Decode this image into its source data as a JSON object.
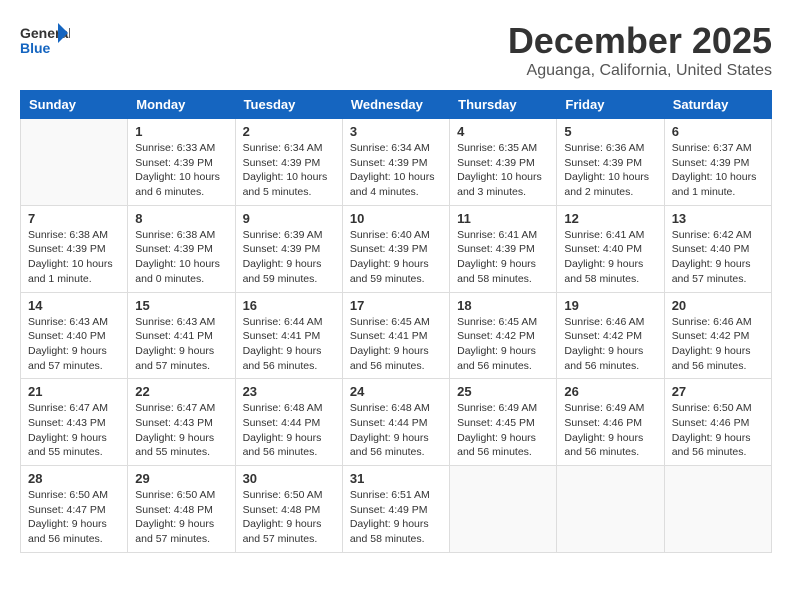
{
  "header": {
    "logo_general": "General",
    "logo_blue": "Blue",
    "month_title": "December 2025",
    "location": "Aguanga, California, United States"
  },
  "weekdays": [
    "Sunday",
    "Monday",
    "Tuesday",
    "Wednesday",
    "Thursday",
    "Friday",
    "Saturday"
  ],
  "days": [
    {
      "date": null,
      "number": "",
      "sunrise": "",
      "sunset": "",
      "daylight": ""
    },
    {
      "date": "1",
      "number": "1",
      "sunrise": "Sunrise: 6:33 AM",
      "sunset": "Sunset: 4:39 PM",
      "daylight": "Daylight: 10 hours and 6 minutes."
    },
    {
      "date": "2",
      "number": "2",
      "sunrise": "Sunrise: 6:34 AM",
      "sunset": "Sunset: 4:39 PM",
      "daylight": "Daylight: 10 hours and 5 minutes."
    },
    {
      "date": "3",
      "number": "3",
      "sunrise": "Sunrise: 6:34 AM",
      "sunset": "Sunset: 4:39 PM",
      "daylight": "Daylight: 10 hours and 4 minutes."
    },
    {
      "date": "4",
      "number": "4",
      "sunrise": "Sunrise: 6:35 AM",
      "sunset": "Sunset: 4:39 PM",
      "daylight": "Daylight: 10 hours and 3 minutes."
    },
    {
      "date": "5",
      "number": "5",
      "sunrise": "Sunrise: 6:36 AM",
      "sunset": "Sunset: 4:39 PM",
      "daylight": "Daylight: 10 hours and 2 minutes."
    },
    {
      "date": "6",
      "number": "6",
      "sunrise": "Sunrise: 6:37 AM",
      "sunset": "Sunset: 4:39 PM",
      "daylight": "Daylight: 10 hours and 1 minute."
    },
    {
      "date": "7",
      "number": "7",
      "sunrise": "Sunrise: 6:38 AM",
      "sunset": "Sunset: 4:39 PM",
      "daylight": "Daylight: 10 hours and 1 minute."
    },
    {
      "date": "8",
      "number": "8",
      "sunrise": "Sunrise: 6:38 AM",
      "sunset": "Sunset: 4:39 PM",
      "daylight": "Daylight: 10 hours and 0 minutes."
    },
    {
      "date": "9",
      "number": "9",
      "sunrise": "Sunrise: 6:39 AM",
      "sunset": "Sunset: 4:39 PM",
      "daylight": "Daylight: 9 hours and 59 minutes."
    },
    {
      "date": "10",
      "number": "10",
      "sunrise": "Sunrise: 6:40 AM",
      "sunset": "Sunset: 4:39 PM",
      "daylight": "Daylight: 9 hours and 59 minutes."
    },
    {
      "date": "11",
      "number": "11",
      "sunrise": "Sunrise: 6:41 AM",
      "sunset": "Sunset: 4:39 PM",
      "daylight": "Daylight: 9 hours and 58 minutes."
    },
    {
      "date": "12",
      "number": "12",
      "sunrise": "Sunrise: 6:41 AM",
      "sunset": "Sunset: 4:40 PM",
      "daylight": "Daylight: 9 hours and 58 minutes."
    },
    {
      "date": "13",
      "number": "13",
      "sunrise": "Sunrise: 6:42 AM",
      "sunset": "Sunset: 4:40 PM",
      "daylight": "Daylight: 9 hours and 57 minutes."
    },
    {
      "date": "14",
      "number": "14",
      "sunrise": "Sunrise: 6:43 AM",
      "sunset": "Sunset: 4:40 PM",
      "daylight": "Daylight: 9 hours and 57 minutes."
    },
    {
      "date": "15",
      "number": "15",
      "sunrise": "Sunrise: 6:43 AM",
      "sunset": "Sunset: 4:41 PM",
      "daylight": "Daylight: 9 hours and 57 minutes."
    },
    {
      "date": "16",
      "number": "16",
      "sunrise": "Sunrise: 6:44 AM",
      "sunset": "Sunset: 4:41 PM",
      "daylight": "Daylight: 9 hours and 56 minutes."
    },
    {
      "date": "17",
      "number": "17",
      "sunrise": "Sunrise: 6:45 AM",
      "sunset": "Sunset: 4:41 PM",
      "daylight": "Daylight: 9 hours and 56 minutes."
    },
    {
      "date": "18",
      "number": "18",
      "sunrise": "Sunrise: 6:45 AM",
      "sunset": "Sunset: 4:42 PM",
      "daylight": "Daylight: 9 hours and 56 minutes."
    },
    {
      "date": "19",
      "number": "19",
      "sunrise": "Sunrise: 6:46 AM",
      "sunset": "Sunset: 4:42 PM",
      "daylight": "Daylight: 9 hours and 56 minutes."
    },
    {
      "date": "20",
      "number": "20",
      "sunrise": "Sunrise: 6:46 AM",
      "sunset": "Sunset: 4:42 PM",
      "daylight": "Daylight: 9 hours and 56 minutes."
    },
    {
      "date": "21",
      "number": "21",
      "sunrise": "Sunrise: 6:47 AM",
      "sunset": "Sunset: 4:43 PM",
      "daylight": "Daylight: 9 hours and 55 minutes."
    },
    {
      "date": "22",
      "number": "22",
      "sunrise": "Sunrise: 6:47 AM",
      "sunset": "Sunset: 4:43 PM",
      "daylight": "Daylight: 9 hours and 55 minutes."
    },
    {
      "date": "23",
      "number": "23",
      "sunrise": "Sunrise: 6:48 AM",
      "sunset": "Sunset: 4:44 PM",
      "daylight": "Daylight: 9 hours and 56 minutes."
    },
    {
      "date": "24",
      "number": "24",
      "sunrise": "Sunrise: 6:48 AM",
      "sunset": "Sunset: 4:44 PM",
      "daylight": "Daylight: 9 hours and 56 minutes."
    },
    {
      "date": "25",
      "number": "25",
      "sunrise": "Sunrise: 6:49 AM",
      "sunset": "Sunset: 4:45 PM",
      "daylight": "Daylight: 9 hours and 56 minutes."
    },
    {
      "date": "26",
      "number": "26",
      "sunrise": "Sunrise: 6:49 AM",
      "sunset": "Sunset: 4:46 PM",
      "daylight": "Daylight: 9 hours and 56 minutes."
    },
    {
      "date": "27",
      "number": "27",
      "sunrise": "Sunrise: 6:50 AM",
      "sunset": "Sunset: 4:46 PM",
      "daylight": "Daylight: 9 hours and 56 minutes."
    },
    {
      "date": "28",
      "number": "28",
      "sunrise": "Sunrise: 6:50 AM",
      "sunset": "Sunset: 4:47 PM",
      "daylight": "Daylight: 9 hours and 56 minutes."
    },
    {
      "date": "29",
      "number": "29",
      "sunrise": "Sunrise: 6:50 AM",
      "sunset": "Sunset: 4:48 PM",
      "daylight": "Daylight: 9 hours and 57 minutes."
    },
    {
      "date": "30",
      "number": "30",
      "sunrise": "Sunrise: 6:50 AM",
      "sunset": "Sunset: 4:48 PM",
      "daylight": "Daylight: 9 hours and 57 minutes."
    },
    {
      "date": "31",
      "number": "31",
      "sunrise": "Sunrise: 6:51 AM",
      "sunset": "Sunset: 4:49 PM",
      "daylight": "Daylight: 9 hours and 58 minutes."
    }
  ]
}
